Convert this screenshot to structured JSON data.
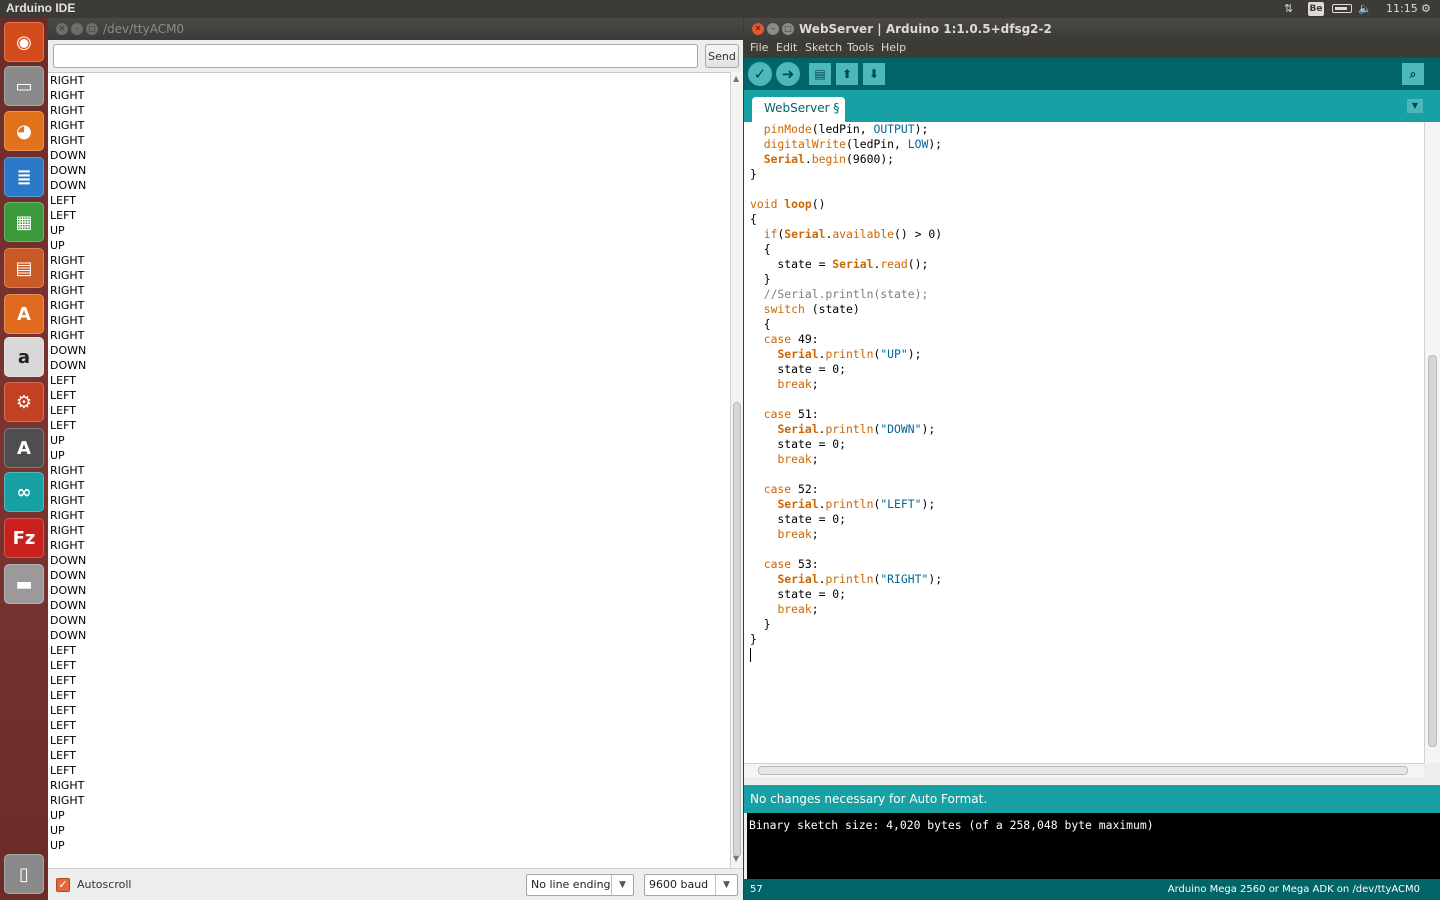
{
  "top_panel": {
    "app_title": "Arduino IDE",
    "keyboard_layout": "Be",
    "clock": "11:15"
  },
  "launcher": {
    "items": [
      {
        "name": "dash",
        "color": "#d44c1c",
        "glyph": "◉"
      },
      {
        "name": "files",
        "color": "#8a8a8a",
        "glyph": "▭"
      },
      {
        "name": "firefox",
        "color": "#e1721b",
        "glyph": "◕"
      },
      {
        "name": "writer",
        "color": "#2a79c9",
        "glyph": "≣"
      },
      {
        "name": "calc",
        "color": "#3c9a3c",
        "glyph": "▦"
      },
      {
        "name": "impress",
        "color": "#c95a26",
        "glyph": "▤"
      },
      {
        "name": "software-center",
        "color": "#e06a20",
        "glyph": "A"
      },
      {
        "name": "amazon",
        "color": "#d8d8d8",
        "glyph": "a"
      },
      {
        "name": "system-settings",
        "color": "#c44022",
        "glyph": "⚙"
      },
      {
        "name": "software-updater",
        "color": "#4e4e4e",
        "glyph": "A"
      },
      {
        "name": "arduino",
        "color": "#17a1a5",
        "glyph": "∞"
      },
      {
        "name": "filezilla",
        "color": "#c8201d",
        "glyph": "Fz"
      },
      {
        "name": "drive",
        "color": "#9a9a9a",
        "glyph": "▬"
      },
      {
        "name": "trash",
        "color": "#8a8a8a",
        "glyph": "▯"
      }
    ]
  },
  "serial_monitor": {
    "title": "/dev/ttyACM0",
    "input_value": "",
    "send_label": "Send",
    "output_lines": [
      "RIGHT",
      "RIGHT",
      "RIGHT",
      "RIGHT",
      "RIGHT",
      "DOWN",
      "DOWN",
      "DOWN",
      "LEFT",
      "LEFT",
      "UP",
      "UP",
      "RIGHT",
      "RIGHT",
      "RIGHT",
      "RIGHT",
      "RIGHT",
      "RIGHT",
      "DOWN",
      "DOWN",
      "LEFT",
      "LEFT",
      "LEFT",
      "LEFT",
      "UP",
      "UP",
      "RIGHT",
      "RIGHT",
      "RIGHT",
      "RIGHT",
      "RIGHT",
      "RIGHT",
      "DOWN",
      "DOWN",
      "DOWN",
      "DOWN",
      "DOWN",
      "DOWN",
      "LEFT",
      "LEFT",
      "LEFT",
      "LEFT",
      "LEFT",
      "LEFT",
      "LEFT",
      "LEFT",
      "LEFT",
      "RIGHT",
      "RIGHT",
      "UP",
      "UP",
      "UP"
    ],
    "autoscroll_label": "Autoscroll",
    "autoscroll_checked": true,
    "line_ending": "No line ending",
    "baud_rate": "9600 baud"
  },
  "ide": {
    "title": "WebServer | Arduino 1:1.0.5+dfsg2-2",
    "menu": [
      "File",
      "Edit",
      "Sketch",
      "Tools",
      "Help"
    ],
    "toolbar": [
      "verify",
      "upload",
      "new",
      "open",
      "save",
      "serial-monitor"
    ],
    "tab_label": "WebServer §",
    "code_lines": [
      [
        {
          "t": "  "
        },
        {
          "t": "pinMode",
          "c": "kw"
        },
        {
          "t": "(ledPin, "
        },
        {
          "t": "OUTPUT",
          "c": "cst"
        },
        {
          "t": ");"
        }
      ],
      [
        {
          "t": "  "
        },
        {
          "t": "digitalWrite",
          "c": "kw"
        },
        {
          "t": "(ledPin, "
        },
        {
          "t": "LOW",
          "c": "cst"
        },
        {
          "t": ");"
        }
      ],
      [
        {
          "t": "  "
        },
        {
          "t": "Serial",
          "c": "kwb"
        },
        {
          "t": "."
        },
        {
          "t": "begin",
          "c": "kw"
        },
        {
          "t": "(9600);"
        }
      ],
      [
        {
          "t": "}"
        }
      ],
      [
        {
          "t": ""
        }
      ],
      [
        {
          "t": "void",
          "c": "kw"
        },
        {
          "t": " "
        },
        {
          "t": "loop",
          "c": "kwb"
        },
        {
          "t": "()"
        }
      ],
      [
        {
          "t": "{"
        }
      ],
      [
        {
          "t": "  "
        },
        {
          "t": "if",
          "c": "kw"
        },
        {
          "t": "("
        },
        {
          "t": "Serial",
          "c": "kwb"
        },
        {
          "t": "."
        },
        {
          "t": "available",
          "c": "kw"
        },
        {
          "t": "() > 0)"
        }
      ],
      [
        {
          "t": "  {"
        }
      ],
      [
        {
          "t": "    state = "
        },
        {
          "t": "Serial",
          "c": "kwb"
        },
        {
          "t": "."
        },
        {
          "t": "read",
          "c": "kw"
        },
        {
          "t": "();"
        }
      ],
      [
        {
          "t": "  }"
        }
      ],
      [
        {
          "t": "  //Serial.println(state);",
          "c": "cmt"
        }
      ],
      [
        {
          "t": "  "
        },
        {
          "t": "switch",
          "c": "kw"
        },
        {
          "t": " (state)"
        }
      ],
      [
        {
          "t": "  {"
        }
      ],
      [
        {
          "t": "  "
        },
        {
          "t": "case",
          "c": "kw"
        },
        {
          "t": " 49:"
        }
      ],
      [
        {
          "t": "    "
        },
        {
          "t": "Serial",
          "c": "kwb"
        },
        {
          "t": "."
        },
        {
          "t": "println",
          "c": "kw"
        },
        {
          "t": "("
        },
        {
          "t": "\"UP\"",
          "c": "str"
        },
        {
          "t": ");"
        }
      ],
      [
        {
          "t": "    state = 0;"
        }
      ],
      [
        {
          "t": "    "
        },
        {
          "t": "break",
          "c": "kw"
        },
        {
          "t": ";"
        }
      ],
      [
        {
          "t": ""
        }
      ],
      [
        {
          "t": "  "
        },
        {
          "t": "case",
          "c": "kw"
        },
        {
          "t": " 51:"
        }
      ],
      [
        {
          "t": "    "
        },
        {
          "t": "Serial",
          "c": "kwb"
        },
        {
          "t": "."
        },
        {
          "t": "println",
          "c": "kw"
        },
        {
          "t": "("
        },
        {
          "t": "\"DOWN\"",
          "c": "str"
        },
        {
          "t": ");"
        }
      ],
      [
        {
          "t": "    state = 0;"
        }
      ],
      [
        {
          "t": "    "
        },
        {
          "t": "break",
          "c": "kw"
        },
        {
          "t": ";"
        }
      ],
      [
        {
          "t": ""
        }
      ],
      [
        {
          "t": "  "
        },
        {
          "t": "case",
          "c": "kw"
        },
        {
          "t": " 52:"
        }
      ],
      [
        {
          "t": "    "
        },
        {
          "t": "Serial",
          "c": "kwb"
        },
        {
          "t": "."
        },
        {
          "t": "println",
          "c": "kw"
        },
        {
          "t": "("
        },
        {
          "t": "\"LEFT\"",
          "c": "str"
        },
        {
          "t": ");"
        }
      ],
      [
        {
          "t": "    state = 0;"
        }
      ],
      [
        {
          "t": "    "
        },
        {
          "t": "break",
          "c": "kw"
        },
        {
          "t": ";"
        }
      ],
      [
        {
          "t": ""
        }
      ],
      [
        {
          "t": "  "
        },
        {
          "t": "case",
          "c": "kw"
        },
        {
          "t": " 53:"
        }
      ],
      [
        {
          "t": "    "
        },
        {
          "t": "Serial",
          "c": "kwb"
        },
        {
          "t": "."
        },
        {
          "t": "println",
          "c": "kw"
        },
        {
          "t": "("
        },
        {
          "t": "\"RIGHT\"",
          "c": "str"
        },
        {
          "t": ");"
        }
      ],
      [
        {
          "t": "    state = 0;"
        }
      ],
      [
        {
          "t": "    "
        },
        {
          "t": "break",
          "c": "kw"
        },
        {
          "t": ";"
        }
      ],
      [
        {
          "t": "  }"
        }
      ],
      [
        {
          "t": "}"
        }
      ]
    ],
    "status_message": "No changes necessary for Auto Format.",
    "console_text": "Binary sketch size: 4,020 bytes (of a 258,048 byte maximum)",
    "line_number": "57",
    "board_info": "Arduino Mega 2560 or Mega ADK on /dev/ttyACM0"
  }
}
